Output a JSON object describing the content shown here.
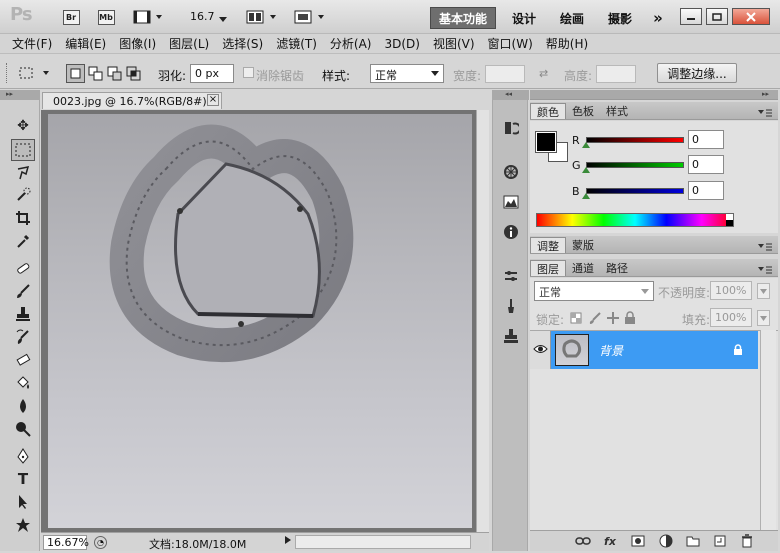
{
  "app": {
    "logo": "Ps"
  },
  "titlebar": {
    "bridge_label": "Br",
    "minibridge_label": "Mb",
    "zoom": "16.7",
    "workspaces": [
      "基本功能",
      "设计",
      "绘画",
      "摄影"
    ],
    "more": "»"
  },
  "menu": [
    "文件(F)",
    "编辑(E)",
    "图像(I)",
    "图层(L)",
    "选择(S)",
    "滤镜(T)",
    "分析(A)",
    "3D(D)",
    "视图(V)",
    "窗口(W)",
    "帮助(H)"
  ],
  "options": {
    "feather_label": "羽化:",
    "feather_value": "0 px",
    "antialias_label": "消除锯齿",
    "style_label": "样式:",
    "style_value": "正常",
    "width_label": "宽度:",
    "height_label": "高度:",
    "refine_edge": "调整边缘..."
  },
  "document": {
    "tab_title": "0023.jpg @ 16.7%(RGB/8#)",
    "close": "×",
    "zoom_status": "16.67%",
    "doc_info": "文档:18.0M/18.0M"
  },
  "color_panel": {
    "tabs": [
      "颜色",
      "色板",
      "样式"
    ],
    "r_label": "R",
    "g_label": "G",
    "b_label": "B",
    "r_value": "0",
    "g_value": "0",
    "b_value": "0"
  },
  "adjust_panel": {
    "tabs": [
      "调整",
      "蒙版"
    ]
  },
  "layers_panel": {
    "tabs": [
      "图层",
      "通道",
      "路径"
    ],
    "blend_mode": "正常",
    "opacity_label": "不透明度:",
    "opacity_value": "100%",
    "lock_label": "锁定:",
    "fill_label": "填充:",
    "fill_value": "100%",
    "layer_name": "背景"
  },
  "colors": {
    "selected_layer": "#3d9bf3",
    "foreground": "#000000",
    "background": "#ffffff"
  }
}
